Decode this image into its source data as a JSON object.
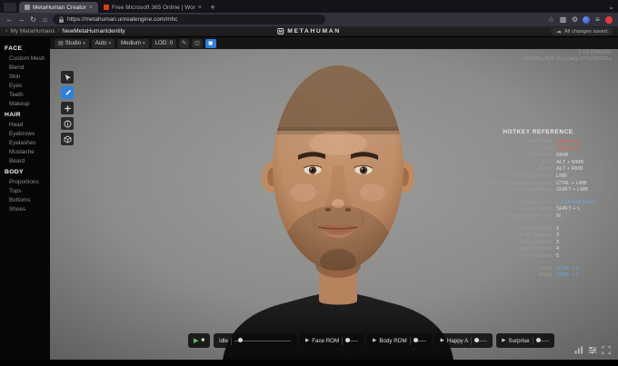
{
  "colors": {
    "accent_blue": "#2f80d8",
    "play_green": "#58c661",
    "hotkey_red": "#e0654d",
    "hotkey_blue": "#6aa6e8",
    "hotkey_white": "#d8d8d8"
  },
  "browser": {
    "tabs": [
      {
        "title": "MetaHuman Creator"
      },
      {
        "title": "Free Microsoft 365 Online | Wor"
      }
    ],
    "url": "https://metahuman.unrealengine.com/mhc"
  },
  "icons": {
    "back": "←",
    "forward": "→",
    "reload": "↻",
    "home": "⌂",
    "star": "☆",
    "extensions": "▩",
    "settings": "⚙",
    "menu": "≡",
    "list_tabs": "⌄",
    "close": "×",
    "new_tab": "+",
    "caret": "▾",
    "play": "▶",
    "stop": "■",
    "cloud": "☁",
    "studio": "▤",
    "pencil": "✎",
    "panels": "◫",
    "preview": "▣",
    "chevron_left": "‹",
    "logo_letter": "M"
  },
  "header": {
    "breadcrumb_root": "My MetaHumans",
    "breadcrumb_sep": "/",
    "breadcrumb_current": "NewMetaHumanIdentity",
    "logo_text": "METAHUMAN",
    "save_status": "All changes saved"
  },
  "toolbar": {
    "studio": "Studio",
    "auto": "Auto",
    "quality": "Medium",
    "lod": "LOD: 0"
  },
  "viewport": {
    "debug_line1": "3 1 A 9795p937",
    "debug_line2": "9R8115p RoS sFca Daca 0741x39b021a"
  },
  "sidebar": {
    "sections": [
      {
        "title": "FACE",
        "items": [
          "Custom Mesh",
          "Blend",
          "Skin",
          "Eyes",
          "Teeth",
          "Makeup"
        ]
      },
      {
        "title": "HAIR",
        "items": [
          "Head",
          "Eyebrows",
          "Eyelashes",
          "Mustache",
          "Beard"
        ]
      },
      {
        "title": "BODY",
        "items": [
          "Proportions",
          "Tops",
          "Bottoms",
          "Shoes"
        ]
      }
    ]
  },
  "hotkeys": {
    "title": "HOTKEY REFERENCE",
    "groups": [
      {
        "rows": [
          {
            "label": "Focus Point",
            "value": "RMB Click",
            "color": "#e0654d"
          },
          {
            "label": "Orbit",
            "value": "RMB Hold",
            "color": "#e0654d"
          },
          {
            "label": "Pan/Orbit",
            "value": "MMB",
            "color": "#d8d8d8"
          },
          {
            "label": "Pan",
            "value": "ALT + MMB",
            "color": "#d8d8d8"
          },
          {
            "label": "Zoom",
            "value": "ALT + RMB",
            "color": "#d8d8d8"
          },
          {
            "label": "Move Sculpt Point",
            "value": "LMB",
            "color": "#d8d8d8"
          },
          {
            "label": "Move Sculpt Point Forward",
            "value": "CTRL + LMB",
            "color": "#d8d8d8"
          },
          {
            "label": "Reset Sculpt Point",
            "value": "SHIFT + LMB",
            "color": "#d8d8d8"
          }
        ]
      },
      {
        "rows": [
          {
            "label": "Rotate Lights",
            "value": "L + Mouse Move",
            "color": "#6aa6e8"
          },
          {
            "label": "Reset Lights",
            "value": "SHIFT + L",
            "color": "#d8d8d8"
          },
          {
            "label": "Toggle Clay Render",
            "value": "M",
            "color": "#d8d8d8"
          }
        ]
      },
      {
        "rows": [
          {
            "label": "Face Camera",
            "value": "1",
            "color": "#d8d8d8"
          },
          {
            "label": "Body Camera",
            "value": "2",
            "color": "#d8d8d8"
          },
          {
            "label": "Torso Camera",
            "value": "3",
            "color": "#d8d8d8"
          },
          {
            "label": "Legs Camera",
            "value": "4",
            "color": "#d8d8d8"
          },
          {
            "label": "Far Camera",
            "value": "5",
            "color": "#d8d8d8"
          }
        ]
      },
      {
        "rows": [
          {
            "label": "Undo",
            "value": "CTRL + Z",
            "color": "#6aa6e8"
          },
          {
            "label": "Redo",
            "value": "CTRL + Y",
            "color": "#6aa6e8"
          }
        ]
      }
    ]
  },
  "playback": {
    "idle": "Idle",
    "clips": [
      "Face ROM",
      "Body ROM",
      "Happy A",
      "Surprise"
    ]
  }
}
